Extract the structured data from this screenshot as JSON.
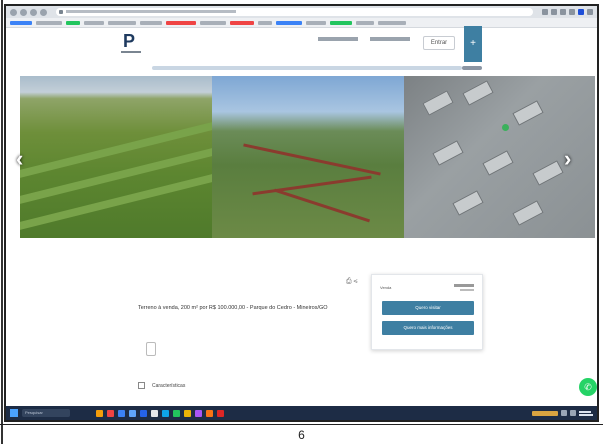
{
  "caption": "6",
  "header": {
    "entrar_label": "Entrar",
    "plus_label": "+"
  },
  "listing": {
    "title": "Terreno à venda, 200 m² por R$ 100.000,00 - Parque do Cedro - Mineiros/GO"
  },
  "sidecard": {
    "price_label": "Venda",
    "btn_primary": "Quero visitar",
    "btn_secondary": "Quero mais informações"
  },
  "features": {
    "label": "Características"
  },
  "taskbar": {
    "search_label": "Pesquisar"
  },
  "colors": {
    "brand": "#3e7fa2",
    "whatsapp": "#25d366",
    "taskbar": "#1d2c45"
  }
}
